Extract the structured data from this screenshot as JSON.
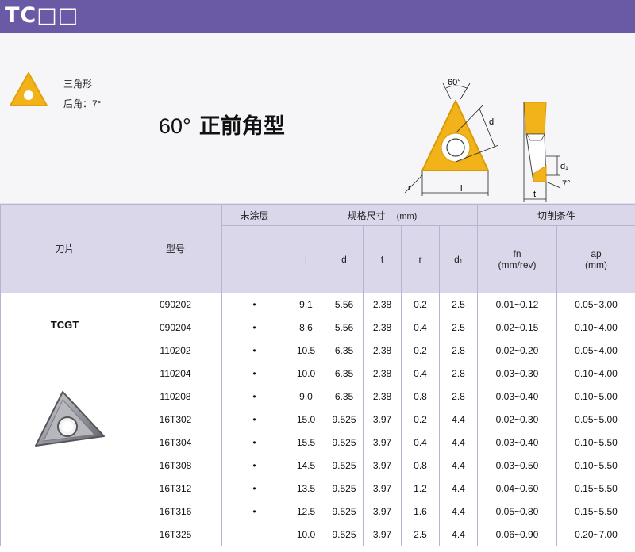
{
  "header": {
    "title": "TC□□"
  },
  "hero": {
    "shape_label": "三角形",
    "clearance_label": "后角：7°",
    "title_angle": "60°",
    "title_text": "正前角型",
    "diagram_labels": {
      "angle": "60°",
      "d": "d",
      "l": "l",
      "r": "r",
      "d1": "d₁",
      "t": "t",
      "clearance": "7°"
    }
  },
  "table": {
    "headers": {
      "blade": "刀片",
      "model": "型号",
      "uncoated": "未涂层",
      "dims": "规格尺寸",
      "dims_unit": "(mm)",
      "cutting": "切削条件",
      "l": "l",
      "d": "d",
      "t": "t",
      "r": "r",
      "d1": "d₁",
      "fn": "fn",
      "fn_unit": "(mm/rev)",
      "ap": "ap",
      "ap_unit": "(mm)"
    },
    "blade_name": "TCGT",
    "rows": [
      {
        "model": "090202",
        "mark": "•",
        "l": "9.1",
        "d": "5.56",
        "t": "2.38",
        "r": "0.2",
        "d1": "2.5",
        "fn": "0.01~0.12",
        "ap": "0.05~3.00"
      },
      {
        "model": "090204",
        "mark": "•",
        "l": "8.6",
        "d": "5.56",
        "t": "2.38",
        "r": "0.4",
        "d1": "2.5",
        "fn": "0.02~0.15",
        "ap": "0.10~4.00"
      },
      {
        "model": "110202",
        "mark": "•",
        "l": "10.5",
        "d": "6.35",
        "t": "2.38",
        "r": "0.2",
        "d1": "2.8",
        "fn": "0.02~0.20",
        "ap": "0.05~4.00"
      },
      {
        "model": "110204",
        "mark": "•",
        "l": "10.0",
        "d": "6.35",
        "t": "2.38",
        "r": "0.4",
        "d1": "2.8",
        "fn": "0.03~0.30",
        "ap": "0.10~4.00"
      },
      {
        "model": "110208",
        "mark": "•",
        "l": "9.0",
        "d": "6.35",
        "t": "2.38",
        "r": "0.8",
        "d1": "2.8",
        "fn": "0.03~0.40",
        "ap": "0.10~5.00"
      },
      {
        "model": "16T302",
        "mark": "•",
        "l": "15.0",
        "d": "9.525",
        "t": "3.97",
        "r": "0.2",
        "d1": "4.4",
        "fn": "0.02~0.30",
        "ap": "0.05~5.00"
      },
      {
        "model": "16T304",
        "mark": "•",
        "l": "15.5",
        "d": "9.525",
        "t": "3.97",
        "r": "0.4",
        "d1": "4.4",
        "fn": "0.03~0.40",
        "ap": "0.10~5.50"
      },
      {
        "model": "16T308",
        "mark": "•",
        "l": "14.5",
        "d": "9.525",
        "t": "3.97",
        "r": "0.8",
        "d1": "4.4",
        "fn": "0.03~0.50",
        "ap": "0.10~5.50"
      },
      {
        "model": "16T312",
        "mark": "•",
        "l": "13.5",
        "d": "9.525",
        "t": "3.97",
        "r": "1.2",
        "d1": "4.4",
        "fn": "0.04~0.60",
        "ap": "0.15~5.50"
      },
      {
        "model": "16T316",
        "mark": "•",
        "l": "12.5",
        "d": "9.525",
        "t": "3.97",
        "r": "1.6",
        "d1": "4.4",
        "fn": "0.05~0.80",
        "ap": "0.15~5.50"
      },
      {
        "model": "16T325",
        "mark": "",
        "l": "10.0",
        "d": "9.525",
        "t": "3.97",
        "r": "2.5",
        "d1": "4.4",
        "fn": "0.06~0.90",
        "ap": "0.20~7.00"
      }
    ]
  },
  "colors": {
    "header_bg": "#6a5aa5",
    "insert_gold": "#f2b31a",
    "table_header_bg": "#d9d7e9"
  }
}
